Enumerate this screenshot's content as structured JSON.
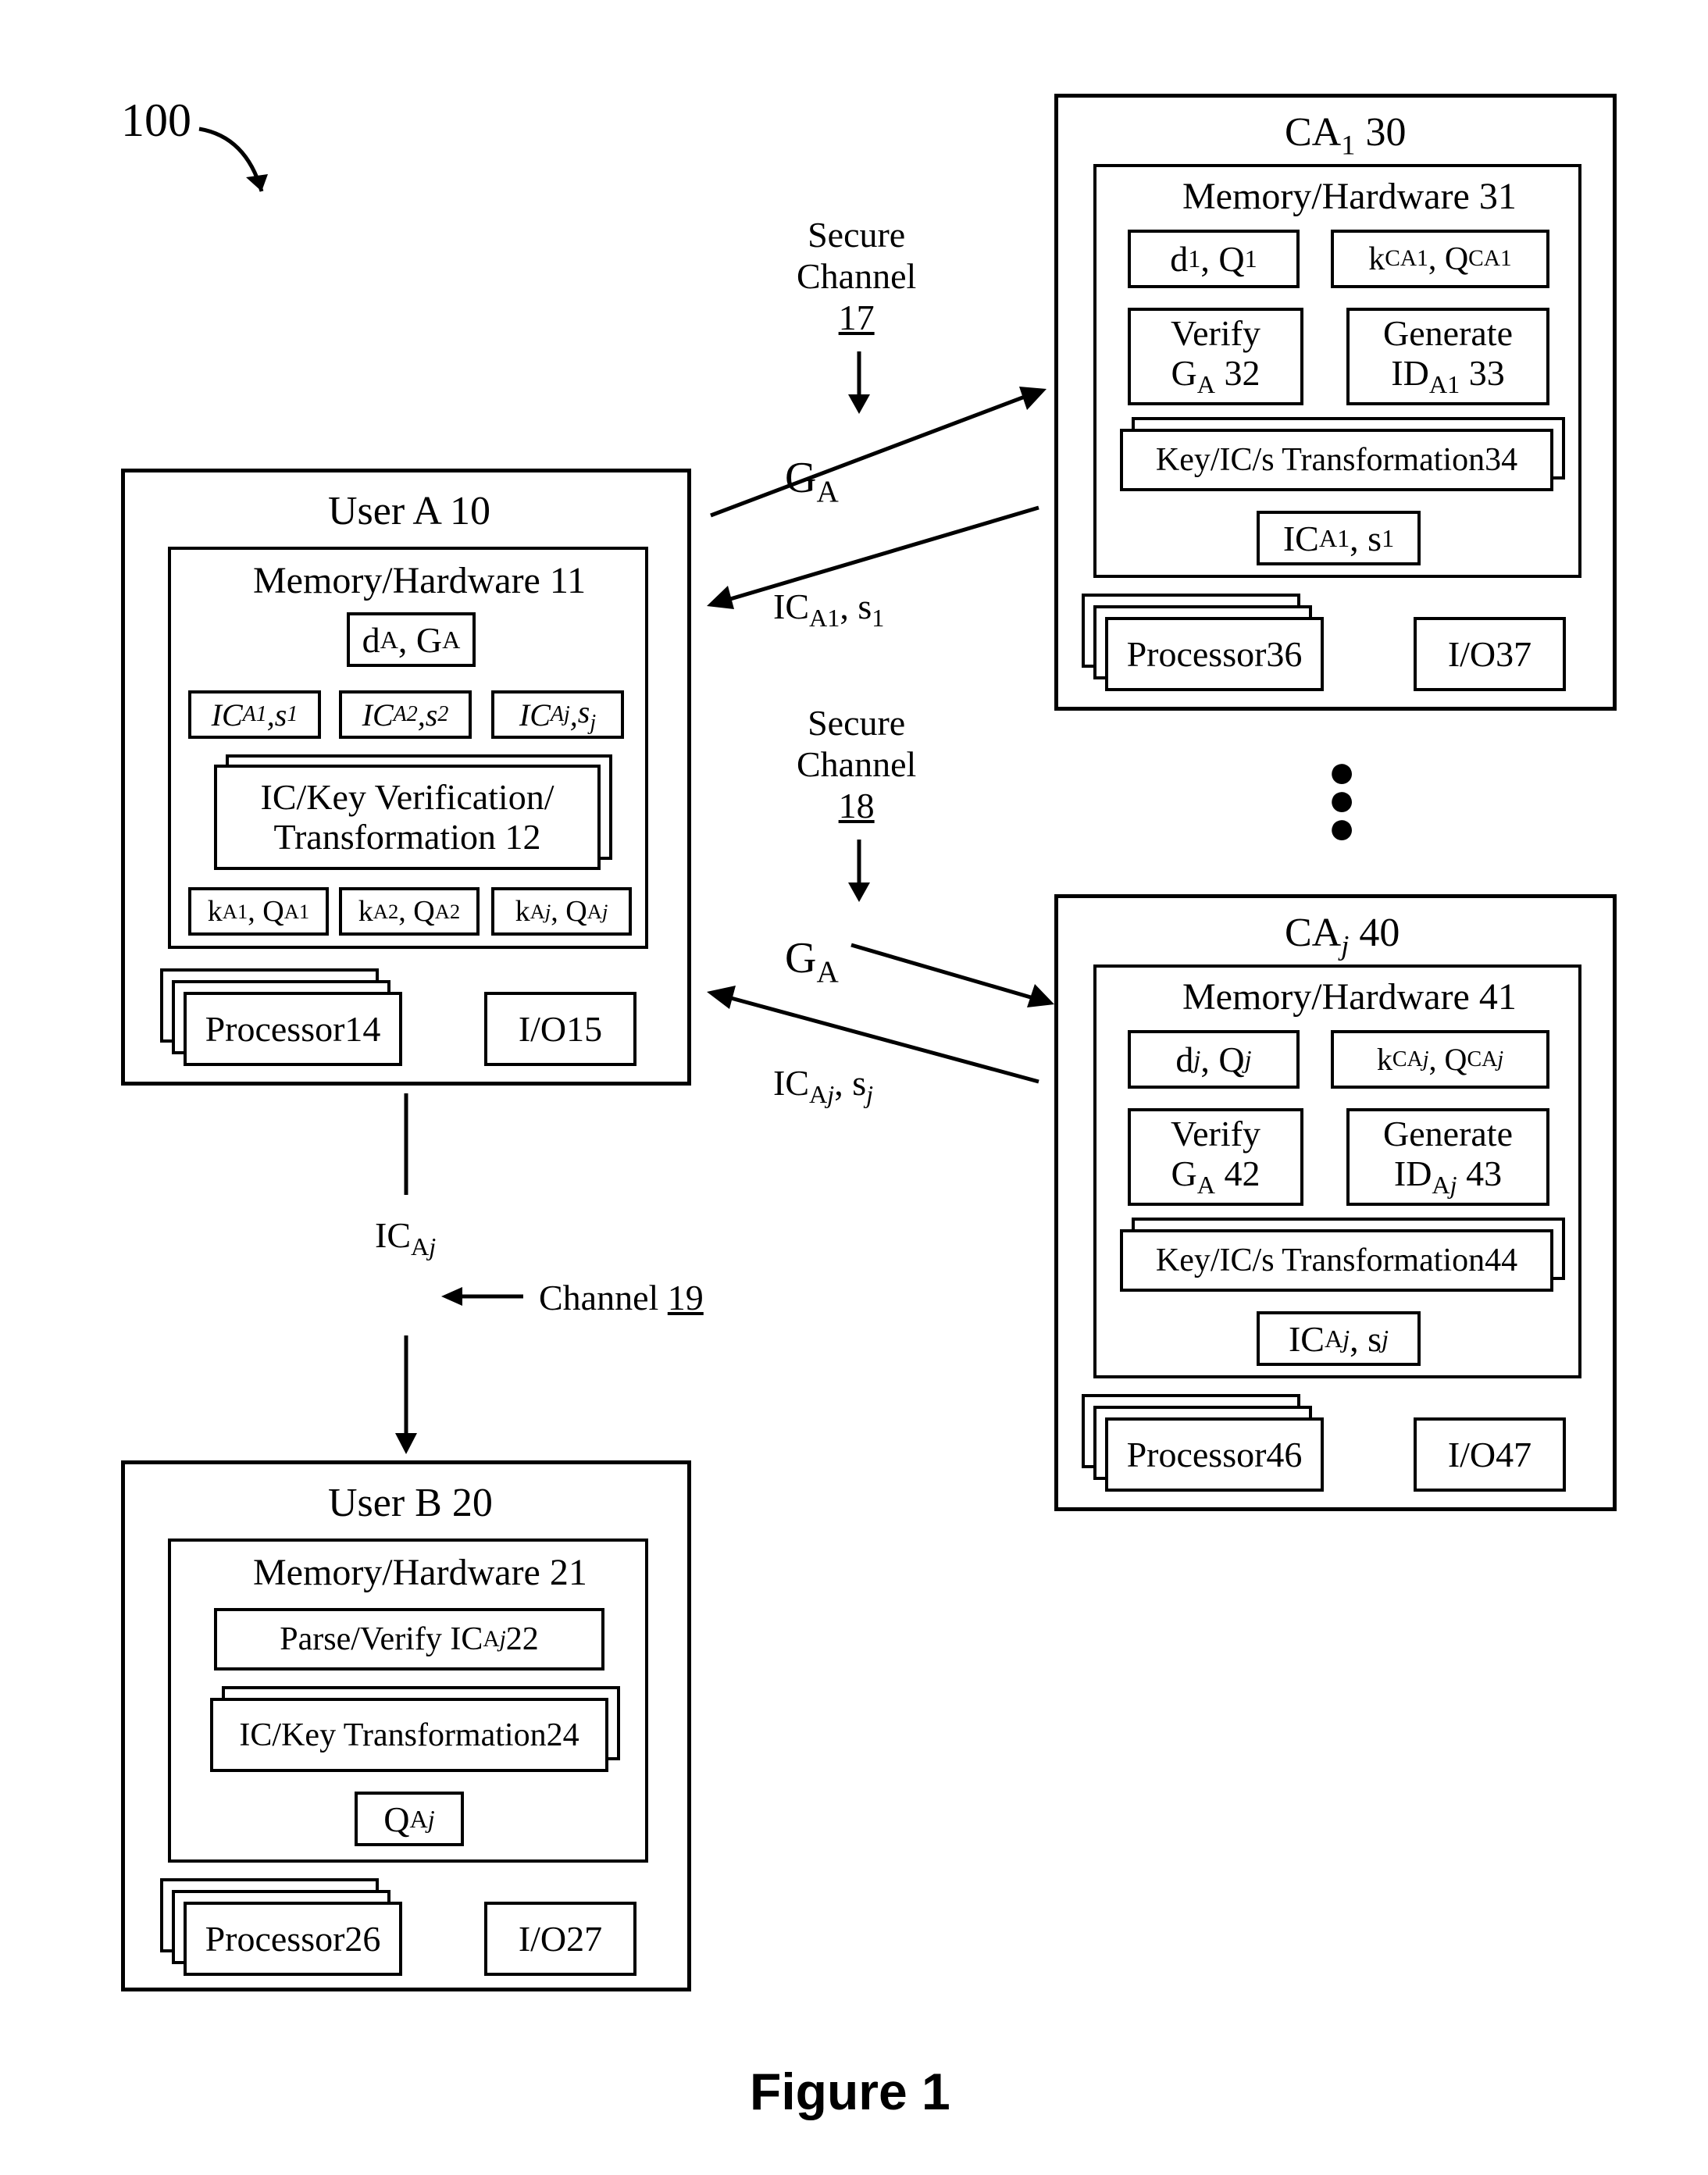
{
  "refNum": "100",
  "figureCaption": "Figure 1",
  "userA": {
    "title_html": "User A <span class='under'>10</span>",
    "mem_html": "Memory/Hardware <span class='under'>11</span>",
    "dG_html": "d<sub>A</sub>, G<sub>A</sub>",
    "ic1_html": "<i>IC</i><sub>A1</sub>, <i>s</i><sub>1</sub>",
    "ic2_html": "<i>IC</i><sub>A2</sub>, <i>s</i><sub>2</sub>",
    "icj_html": "<i>IC</i><sub>A<i>j</i></sub>, <i>s<sub>j</sub></i>",
    "verify_l1": "IC/Key Verification/",
    "verify_l2_html": "Transformation <span class='under'>12</span>",
    "k1_html": "k<sub>A1</sub>, Q<sub>A1</sub>",
    "k2_html": "k<sub>A2</sub>, Q<sub>A2</sub>",
    "kj_html": "k<sub>A<i>j</i></sub>, Q<sub>A<i>j</i></sub>",
    "proc_html": "Processor <span class='under'>14</span>",
    "io_html": "I/O <span class='under'>15</span>"
  },
  "userB": {
    "title_html": "User B <span class='under'>20</span>",
    "mem_html": "Memory/Hardware <span class='under'>21</span>",
    "parse_html": "Parse/Verify IC<sub>A<i>j</i></sub> <span class='under'>22</span>",
    "trans_html": "IC/Key Transformation <span class='under'>24</span>",
    "q_html": "Q<sub>A<i>j</i></sub>",
    "proc_html": "Processor <span class='under'>26</span>",
    "io_html": "I/O <span class='under'>27</span>"
  },
  "ca1": {
    "title_html": "CA<sub>1</sub> <span class='under'>30</span>",
    "mem_html": "Memory/Hardware <span class='under'>31</span>",
    "dq_html": "d<sub>1</sub>, Q<sub>1</sub>",
    "kq_html": "k<sub>CA1</sub>, Q<sub>CA1</sub>",
    "verify_l1": "Verify",
    "verify_l2_html": "G<sub>A</sub> <span class='under'>32</span>",
    "gen_l1": "Generate",
    "gen_l2_html": "ID<sub>A1</sub> <span class='under'>33</span>",
    "trans_html": "Key/IC/s Transformation <span class='under'>34</span>",
    "ics_html": "IC<sub>A1</sub>, s<sub>1</sub>",
    "proc_html": "Processor <span class='under'>36</span>",
    "io_html": "I/O <span class='under'>37</span>"
  },
  "caj": {
    "title_html": "CA<sub><i>j</i></sub> <span class='under'>40</span>",
    "mem_html": "Memory/Hardware <span class='under'>41</span>",
    "dq_html": "d<sub><i>j</i></sub>, Q<sub><i>j</i></sub>",
    "kq_html": "k<sub>CA<i>j</i></sub>, Q<sub>CA<i>j</i></sub>",
    "verify_l1": "Verify",
    "verify_l2_html": "G<sub>A</sub> <span class='under'>42</span>",
    "gen_l1": "Generate",
    "gen_l2_html": "ID<sub>A<i>j</i></sub> <span class='under'>43</span>",
    "trans_html": "Key/IC/s Transformation <span class='under'>44</span>",
    "ics_html": "IC<sub>A<i>j</i></sub>, s<sub><i>j</i></sub>",
    "proc_html": "Processor <span class='under'>46</span>",
    "io_html": "I/O <span class='under'>47</span>"
  },
  "labels": {
    "secure17_l1": "Secure",
    "secure17_l2": "Channel",
    "secure17_l3_html": "<span class='under'>17</span>",
    "secure18_l1": "Secure",
    "secure18_l2": "Channel",
    "secure18_l3_html": "<span class='under'>18</span>",
    "GA_html": "G<sub>A</sub>",
    "ICA1_s1_html": "IC<sub>A1</sub>, s<sub>1</sub>",
    "ICAj_sj_html": "IC<sub>A<i>j</i></sub>, s<sub><i>j</i></sub>",
    "ICAj_html": "IC<sub>A<i>j</i></sub>",
    "channel19_html": "Channel <span class='under'>19</span>"
  }
}
